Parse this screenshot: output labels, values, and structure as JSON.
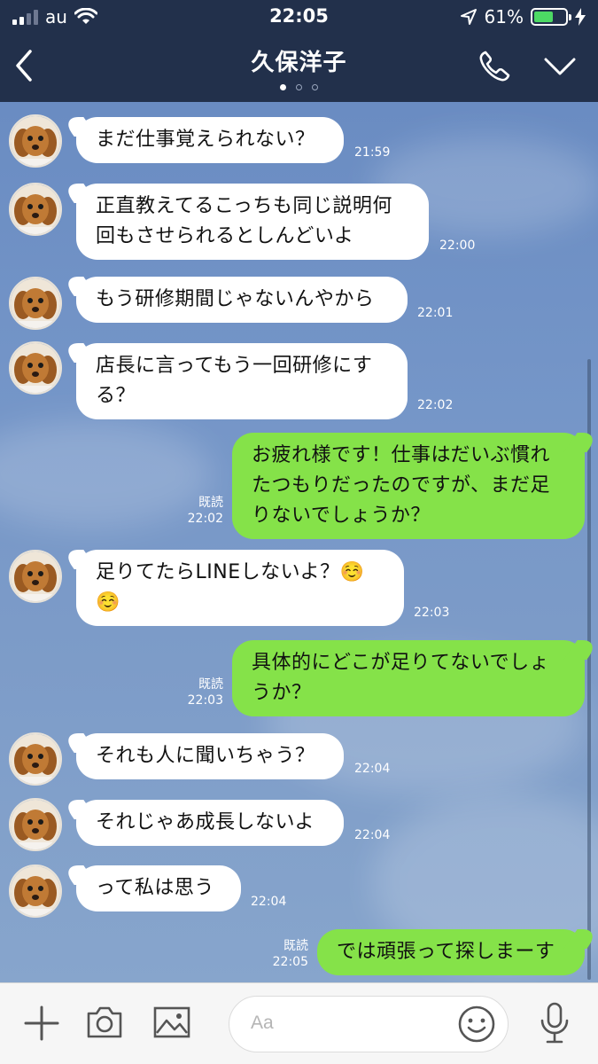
{
  "status_bar": {
    "carrier": "au",
    "time": "22:05",
    "battery_percent": "61%",
    "battery_level": 0.61,
    "icons": [
      "signal-icon",
      "wifi-icon",
      "location-arrow-icon",
      "battery-icon",
      "charging-bolt-icon"
    ]
  },
  "header": {
    "title": "久保洋子",
    "page_indicator": {
      "count": 3,
      "active": 1
    },
    "icons": [
      "back-chevron-icon",
      "phone-icon",
      "chevron-down-icon"
    ]
  },
  "colors": {
    "header_bg": "#22304b",
    "chat_bg": "#7596c8",
    "outgoing_bubble": "#85e249",
    "incoming_bubble": "#ffffff"
  },
  "messages": [
    {
      "dir": "in",
      "text": "まだ仕事覚えられない？",
      "time": "21:59"
    },
    {
      "dir": "in",
      "text": "正直教えてるこっちも同じ説明何回もさせられるとしんどいよ",
      "time": "22:00"
    },
    {
      "dir": "in",
      "text": "もう研修期間じゃないんやから",
      "time": "22:01"
    },
    {
      "dir": "in",
      "text": "店長に言ってもう一回研修にする？",
      "time": "22:02"
    },
    {
      "dir": "out",
      "text": "お疲れ様です！仕事はだいぶ慣れたつもりだったのですが、まだ足りないでしょうか？",
      "time": "22:02",
      "read": "既読"
    },
    {
      "dir": "in",
      "text": "足りてたらLINEしないよ？☺️☺️",
      "time": "22:03"
    },
    {
      "dir": "out",
      "text": "具体的にどこが足りてないでしょうか？",
      "time": "22:03",
      "read": "既読"
    },
    {
      "dir": "in",
      "text": "それも人に聞いちゃう？",
      "time": "22:04"
    },
    {
      "dir": "in",
      "text": "それじゃあ成長しないよ",
      "time": "22:04"
    },
    {
      "dir": "in",
      "text": "って私は思う",
      "time": "22:04"
    },
    {
      "dir": "out",
      "text": "では頑張って探しまーす",
      "time": "22:05",
      "read": "既読"
    }
  ],
  "input_bar": {
    "placeholder": "Aa",
    "icons": [
      "plus-icon",
      "camera-icon",
      "image-icon",
      "emoji-icon",
      "microphone-icon"
    ]
  }
}
